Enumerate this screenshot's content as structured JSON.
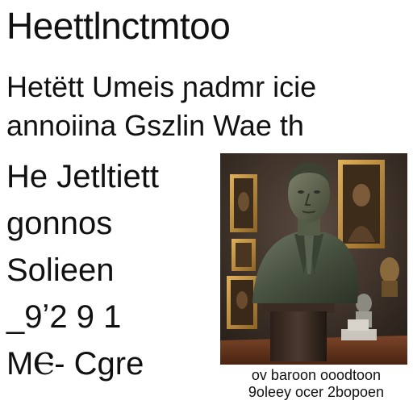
{
  "title": "Heettlnctmtoo",
  "subtitle": {
    "line1": "Hetëtt Umeis ɲadmr icie",
    "line2": "annoiina Gszlin Wae th"
  },
  "left_lines": [
    "He Jetltiett",
    "gonnos",
    "Solieen",
    "_9ʼ2 9 1",
    "MⲈ- Cgre"
  ],
  "image": {
    "subject": "bronze bust in gallery with framed paintings",
    "colors": {
      "wall": "#3a302a",
      "bronze": "#4f5a4c",
      "frame_gold": "#b88a3c",
      "floor": "#6a3a22"
    }
  },
  "caption": {
    "line1": "ov baroon ooodtoon",
    "line2": "9oleey ocer 2bopoen"
  }
}
